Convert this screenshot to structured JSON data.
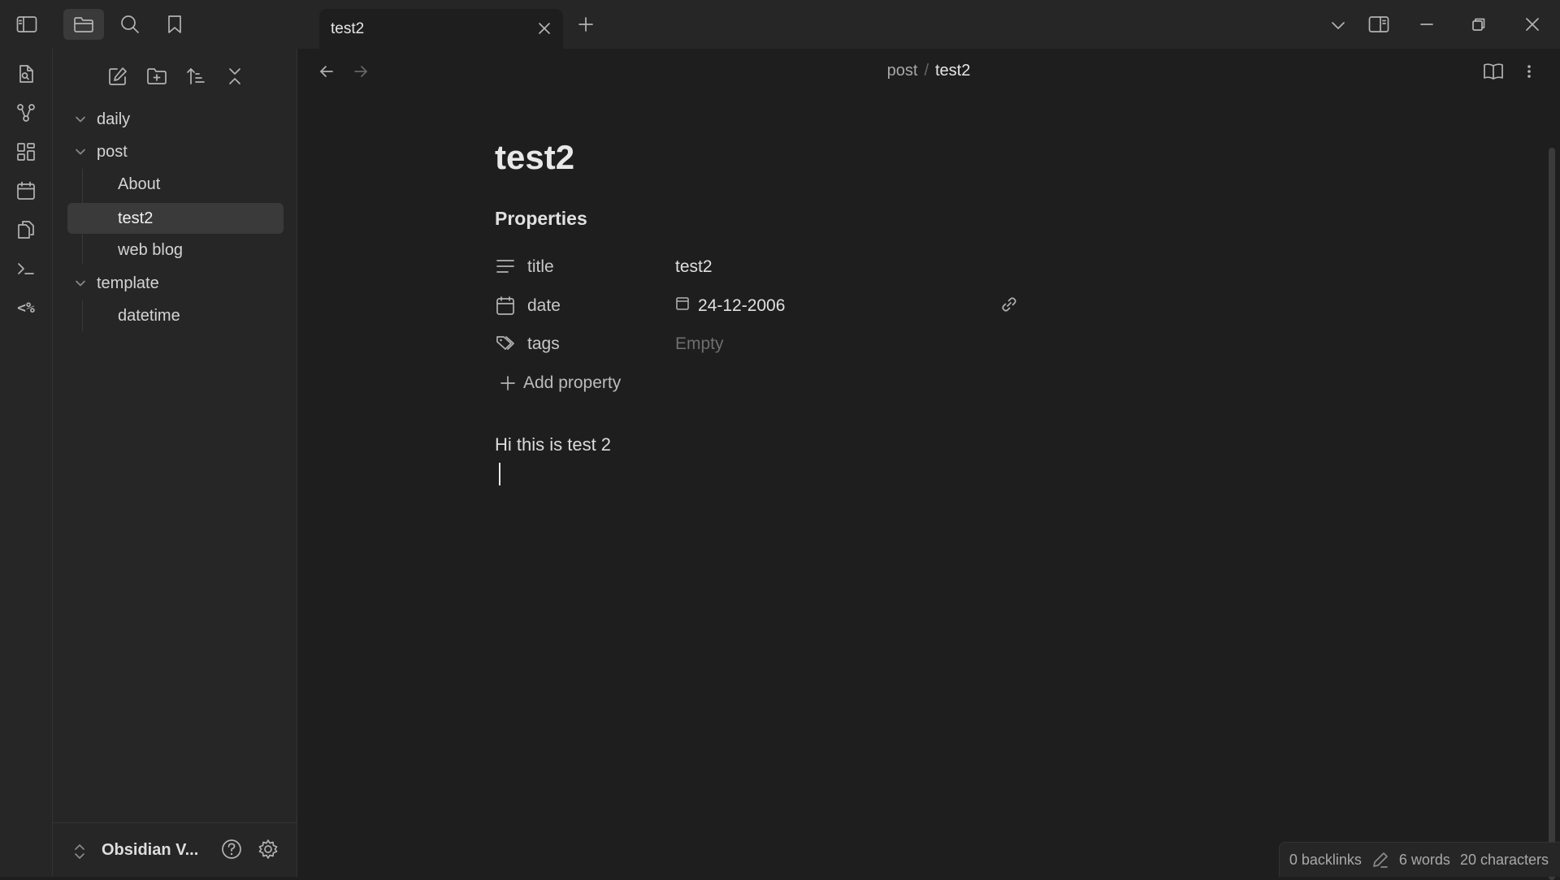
{
  "tabs": [
    {
      "label": "test2"
    }
  ],
  "sidebar": {
    "tree": [
      {
        "label": "daily"
      },
      {
        "label": "post"
      },
      {
        "label": "About"
      },
      {
        "label": "test2"
      },
      {
        "label": "web blog"
      },
      {
        "label": "template"
      },
      {
        "label": "datetime"
      }
    ],
    "vault_name": "Obsidian V..."
  },
  "ribbon": {
    "templater_label": "<%"
  },
  "breadcrumb": {
    "parent": "post",
    "separator": "/",
    "current": "test2"
  },
  "note": {
    "title": "test2",
    "properties_heading": "Properties",
    "properties": [
      {
        "key": "title",
        "value": "test2"
      },
      {
        "key": "date",
        "value": "24-12-2006"
      },
      {
        "key": "tags",
        "value": "Empty"
      }
    ],
    "add_property_label": "Add property",
    "body": "Hi this is test 2"
  },
  "status": {
    "backlinks": "0 backlinks",
    "words": "6 words",
    "characters": "20 characters"
  },
  "icons": {
    "left-sidebar-toggle": "sidebar-left-icon",
    "files": "folder-icon",
    "search": "search-icon",
    "bookmarks": "bookmark-icon",
    "new-tab": "plus-icon",
    "tab-list": "chevron-down-icon",
    "right-sidebar-toggle": "sidebar-right-icon",
    "reading-view": "book-open-icon",
    "more-options": "more-vertical-icon"
  },
  "colors": {
    "app_background": "#1e1e1e",
    "chrome_background": "#262626",
    "active_item_background": "#3a3a3a",
    "muted_text": "#6e6e6e"
  }
}
